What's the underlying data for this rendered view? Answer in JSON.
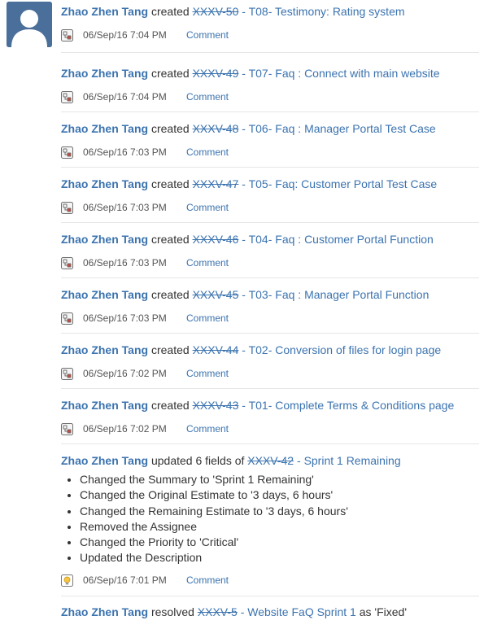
{
  "activities": [
    {
      "user": "Zhao Zhen Tang",
      "verb": "created",
      "issue_key": "XXXV-50",
      "issue_title": "T08- Testimony: Rating system",
      "timestamp": "06/Sep/16 7:04 PM",
      "comment_label": "Comment",
      "icon": "subtask-icon",
      "with_avatar": true
    },
    {
      "user": "Zhao Zhen Tang",
      "verb": "created",
      "issue_key": "XXXV-49",
      "issue_title": "T07- Faq : Connect with main website",
      "timestamp": "06/Sep/16 7:04 PM",
      "comment_label": "Comment",
      "icon": "subtask-icon"
    },
    {
      "user": "Zhao Zhen Tang",
      "verb": "created",
      "issue_key": "XXXV-48",
      "issue_title": "T06- Faq : Manager Portal Test Case",
      "timestamp": "06/Sep/16 7:03 PM",
      "comment_label": "Comment",
      "icon": "subtask-icon"
    },
    {
      "user": "Zhao Zhen Tang",
      "verb": "created",
      "issue_key": "XXXV-47",
      "issue_title": "T05- Faq: Customer Portal Test Case",
      "timestamp": "06/Sep/16 7:03 PM",
      "comment_label": "Comment",
      "icon": "subtask-icon"
    },
    {
      "user": "Zhao Zhen Tang",
      "verb": "created",
      "issue_key": "XXXV-46",
      "issue_title": "T04- Faq : Customer Portal Function",
      "timestamp": "06/Sep/16 7:03 PM",
      "comment_label": "Comment",
      "icon": "subtask-icon"
    },
    {
      "user": "Zhao Zhen Tang",
      "verb": "created",
      "issue_key": "XXXV-45",
      "issue_title": "T03- Faq : Manager Portal Function",
      "timestamp": "06/Sep/16 7:03 PM",
      "comment_label": "Comment",
      "icon": "subtask-icon"
    },
    {
      "user": "Zhao Zhen Tang",
      "verb": "created",
      "issue_key": "XXXV-44",
      "issue_title": "T02- Conversion of files for login page",
      "timestamp": "06/Sep/16 7:02 PM",
      "comment_label": "Comment",
      "icon": "subtask-icon"
    },
    {
      "user": "Zhao Zhen Tang",
      "verb": "created",
      "issue_key": "XXXV-43",
      "issue_title": "T01- Complete Terms & Conditions page",
      "timestamp": "06/Sep/16 7:02 PM",
      "comment_label": "Comment",
      "icon": "subtask-icon"
    },
    {
      "user": "Zhao Zhen Tang",
      "verb": "updated 6 fields of",
      "issue_key": "XXXV-42",
      "issue_title": "Sprint 1 Remaining",
      "timestamp": "06/Sep/16 7:01 PM",
      "comment_label": "Comment",
      "icon": "improvement-icon",
      "changes": [
        "Changed the Summary to 'Sprint 1 Remaining'",
        "Changed the Original Estimate to '3 days, 6 hours'",
        "Changed the Remaining Estimate to '3 days, 6 hours'",
        "Removed the Assignee",
        "Changed the Priority to 'Critical'",
        "Updated the Description"
      ]
    },
    {
      "user": "Zhao Zhen Tang",
      "verb": "resolved",
      "issue_key": "XXXV-5",
      "issue_title": "Website FaQ Sprint 1",
      "suffix": "as 'Fixed'"
    }
  ],
  "colors": {
    "link": "#3b73af",
    "text": "#333333",
    "meta": "#555555",
    "avatar_bg": "#4a6f9a"
  }
}
